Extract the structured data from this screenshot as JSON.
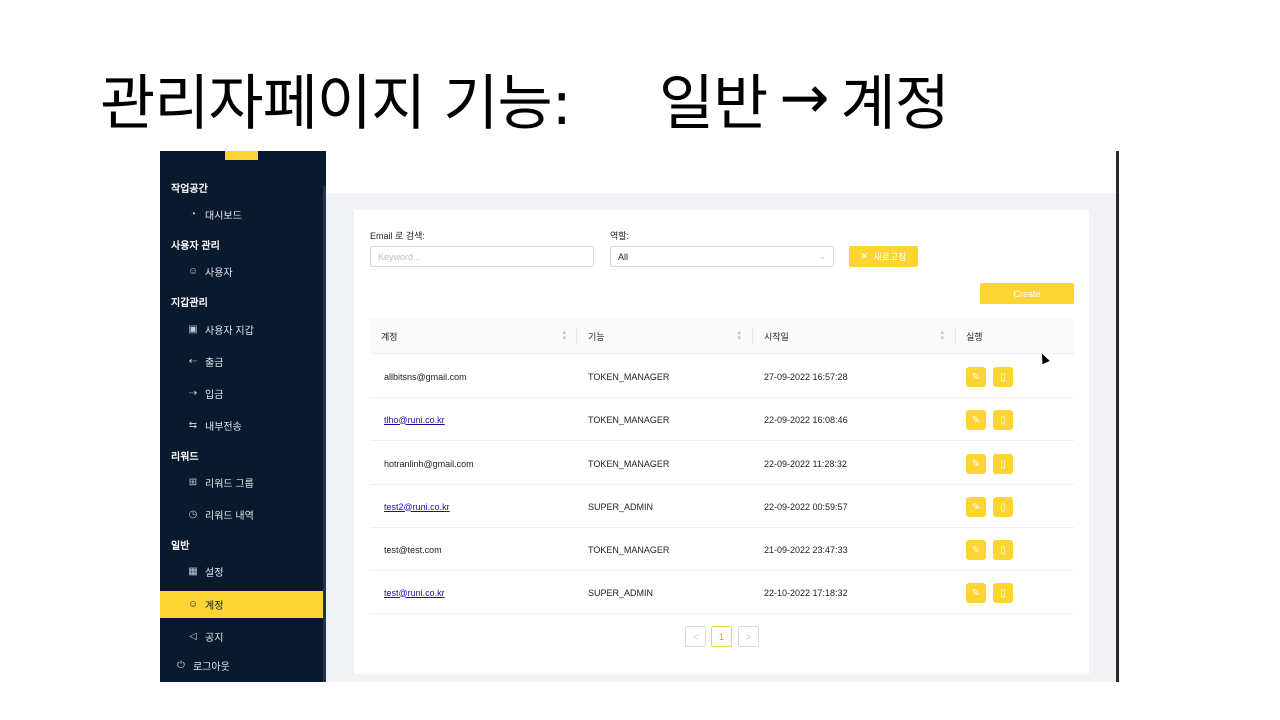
{
  "slide": {
    "title_left": "관리자페이지 기능:",
    "title_right_a": "일반",
    "title_arrow": "→",
    "title_right_b": "계정"
  },
  "sidebar": {
    "groups": [
      {
        "label": "작업공간",
        "items": [
          {
            "label": "대시보드",
            "icon": "dashboard-icon"
          }
        ]
      },
      {
        "label": "사용자 관리",
        "items": [
          {
            "label": "사용자",
            "icon": "user-icon"
          }
        ]
      },
      {
        "label": "지갑관리",
        "items": [
          {
            "label": "사용자 지갑",
            "icon": "wallet-icon"
          },
          {
            "label": "출금",
            "icon": "withdraw-icon"
          },
          {
            "label": "입금",
            "icon": "deposit-icon"
          },
          {
            "label": "내부전송",
            "icon": "transfer-icon"
          }
        ]
      },
      {
        "label": "리워드",
        "items": [
          {
            "label": "리워드 그룹",
            "icon": "gift-icon"
          },
          {
            "label": "리워드 내역",
            "icon": "history-icon"
          }
        ]
      },
      {
        "label": "일반",
        "items": [
          {
            "label": "설정",
            "icon": "grid-icon"
          },
          {
            "label": "계정",
            "icon": "user-icon",
            "active": true
          },
          {
            "label": "공지",
            "icon": "megaphone-icon"
          }
        ]
      }
    ],
    "logout": "로그아웃",
    "accent_color": "#fcd535",
    "bg_color": "#0a1a2e"
  },
  "filters": {
    "email_label": "Email 로 검색:",
    "email_placeholder": "Keyword...",
    "role_label": "역할:",
    "role_value": "All",
    "reset_label": "새로고침",
    "create_label": "Create"
  },
  "table": {
    "columns": [
      "계정",
      "기능",
      "시작일",
      "실행"
    ],
    "rows": [
      {
        "account": "allbitsns@gmail.com",
        "role": "TOKEN_MANAGER",
        "start": "27-09-2022 16:57:28",
        "link": false
      },
      {
        "account": "tlho@runi.co.kr",
        "role": "TOKEN_MANAGER",
        "start": "22-09-2022 16:08:46",
        "link": true
      },
      {
        "account": "hotranlinh@gmail.com",
        "role": "TOKEN_MANAGER",
        "start": "22-09-2022 11:28:32",
        "link": false
      },
      {
        "account": "test2@runi.co.kr",
        "role": "SUPER_ADMIN",
        "start": "22-09-2022 00:59:57",
        "link": true
      },
      {
        "account": "test@test.com",
        "role": "TOKEN_MANAGER",
        "start": "21-09-2022 23:47:33",
        "link": false
      },
      {
        "account": "test@runi.co.kr",
        "role": "SUPER_ADMIN",
        "start": "22-10-2022 17:18:32",
        "link": true
      }
    ]
  },
  "pagination": {
    "prev": "<",
    "current": "1",
    "next": ">"
  }
}
